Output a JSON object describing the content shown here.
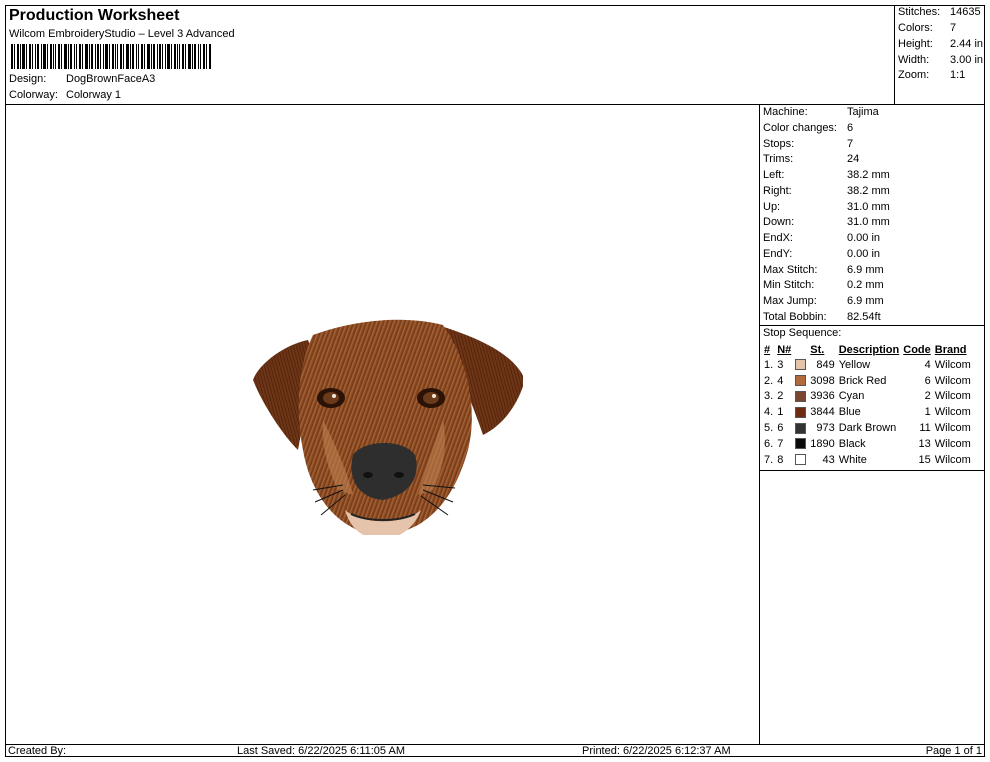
{
  "header": {
    "title": "Production Worksheet",
    "subtitle": "Wilcom EmbroideryStudio – Level 3 Advanced",
    "design_label": "Design:",
    "design_value": "DogBrownFaceA3",
    "colorway_label": "Colorway:",
    "colorway_value": "Colorway 1"
  },
  "stats": [
    {
      "label": "Stitches:",
      "value": "14635"
    },
    {
      "label": "Colors:",
      "value": "7"
    },
    {
      "label": "Height:",
      "value": "2.44 in"
    },
    {
      "label": "Width:",
      "value": "3.00 in"
    },
    {
      "label": "Zoom:",
      "value": "1:1"
    }
  ],
  "machine_info": [
    {
      "label": "Machine:",
      "value": "Tajima"
    },
    {
      "label": "Color changes:",
      "value": "6"
    },
    {
      "label": "Stops:",
      "value": "7"
    },
    {
      "label": "Trims:",
      "value": "24"
    },
    {
      "label": "Left:",
      "value": "38.2 mm"
    },
    {
      "label": "Right:",
      "value": "38.2 mm"
    },
    {
      "label": "Up:",
      "value": "31.0 mm"
    },
    {
      "label": "Down:",
      "value": "31.0 mm"
    },
    {
      "label": "EndX:",
      "value": "0.00 in"
    },
    {
      "label": "EndY:",
      "value": "0.00 in"
    },
    {
      "label": "Max Stitch:",
      "value": "6.9 mm"
    },
    {
      "label": "Min Stitch:",
      "value": "0.2 mm"
    },
    {
      "label": "Max Jump:",
      "value": "6.9 mm"
    },
    {
      "label": "Total Bobbin:",
      "value": "82.54ft"
    }
  ],
  "stop_sequence": {
    "title": "Stop Sequence:",
    "columns": [
      "#",
      "N#",
      "St.",
      "Description",
      "Code",
      "Brand"
    ],
    "rows": [
      {
        "num": "1.",
        "n": "3",
        "color": "#e6c3ab",
        "st": "849",
        "desc": "Yellow",
        "code": "4",
        "brand": "Wilcom"
      },
      {
        "num": "2.",
        "n": "4",
        "color": "#b06a3b",
        "st": "3098",
        "desc": "Brick Red",
        "code": "6",
        "brand": "Wilcom"
      },
      {
        "num": "3.",
        "n": "2",
        "color": "#7a4630",
        "st": "3936",
        "desc": "Cyan",
        "code": "2",
        "brand": "Wilcom"
      },
      {
        "num": "4.",
        "n": "1",
        "color": "#6e2b12",
        "st": "3844",
        "desc": "Blue",
        "code": "1",
        "brand": "Wilcom"
      },
      {
        "num": "5.",
        "n": "6",
        "color": "#333333",
        "st": "973",
        "desc": "Dark Brown",
        "code": "11",
        "brand": "Wilcom"
      },
      {
        "num": "6.",
        "n": "7",
        "color": "#0a0a0a",
        "st": "1890",
        "desc": "Black",
        "code": "13",
        "brand": "Wilcom"
      },
      {
        "num": "7.",
        "n": "8",
        "color": "#ffffff",
        "st": "43",
        "desc": "White",
        "code": "15",
        "brand": "Wilcom"
      }
    ]
  },
  "footer": {
    "created_by": "Created By:",
    "last_saved": "Last Saved: 6/22/2025 6:11:05 AM",
    "printed": "Printed: 6/22/2025 6:12:37 AM",
    "page": "Page 1 of 1"
  }
}
